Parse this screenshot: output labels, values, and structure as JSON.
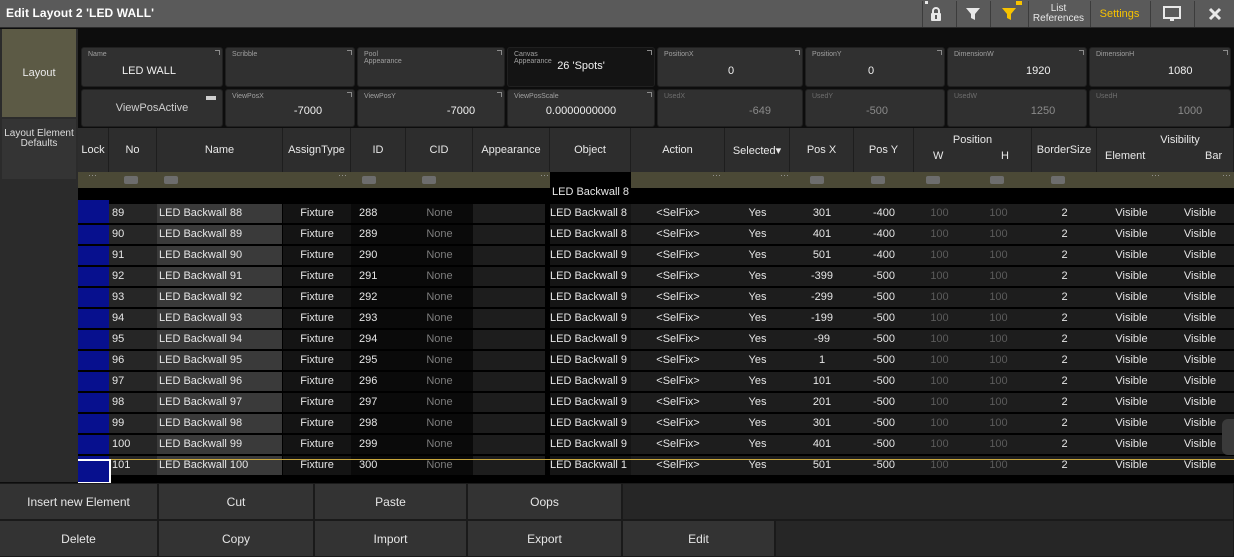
{
  "window": {
    "title": "Edit Layout 2 'LED WALL'"
  },
  "titlebar": {
    "list_references": "List References",
    "settings": "Settings"
  },
  "left_tabs": [
    {
      "label": "Layout"
    },
    {
      "label": "Layout Element Defaults"
    }
  ],
  "fields_row1": [
    {
      "label": "Name",
      "value": "LED WALL"
    },
    {
      "label": "Scribble",
      "value": ""
    },
    {
      "label": "Pool Appearance",
      "value": ""
    },
    {
      "label": "Canvas Appearance",
      "value": "26 'Spots'"
    },
    {
      "label": "PositionX",
      "value": "0"
    },
    {
      "label": "PositionY",
      "value": "0"
    },
    {
      "label": "DimensionW",
      "value": "1920"
    },
    {
      "label": "DimensionH",
      "value": "1080"
    }
  ],
  "fields_row2": [
    {
      "label": "",
      "value": "ViewPosActive"
    },
    {
      "label": "ViewPosX",
      "value": "-7000"
    },
    {
      "label": "ViewPosY",
      "value": "-7000"
    },
    {
      "label": "ViewPosScale",
      "value": "0.0000000000"
    },
    {
      "label": "UsedX",
      "value": "-649"
    },
    {
      "label": "UsedY",
      "value": "-500"
    },
    {
      "label": "UsedW",
      "value": "1250"
    },
    {
      "label": "UsedH",
      "value": "1000"
    }
  ],
  "table": {
    "headers": {
      "lock": "Lock",
      "no": "No",
      "name": "Name",
      "assign": "AssignType",
      "id": "ID",
      "cid": "CID",
      "appearance": "Appearance",
      "object": "Object",
      "action": "Action",
      "selected": "Selected▾",
      "posx": "Pos X",
      "posy": "Pos Y",
      "position": "Position",
      "w": "W",
      "h": "H",
      "bordersize": "BorderSize",
      "visibility": "Visibility",
      "element": "Element",
      "bar": "Bar"
    },
    "first_row_object": "LED Backwall 8",
    "rows": [
      {
        "no": "89",
        "name": "LED Backwall 88",
        "assign": "Fixture",
        "id": "288",
        "cid": "None",
        "object": "LED Backwall 8",
        "action": "<SelFix>",
        "selected": "Yes",
        "posx": "301",
        "posy": "-400",
        "w": "100",
        "h": "100",
        "bs": "2",
        "ve": "Visible",
        "vb": "Visible"
      },
      {
        "no": "90",
        "name": "LED Backwall 89",
        "assign": "Fixture",
        "id": "289",
        "cid": "None",
        "object": "LED Backwall 8",
        "action": "<SelFix>",
        "selected": "Yes",
        "posx": "401",
        "posy": "-400",
        "w": "100",
        "h": "100",
        "bs": "2",
        "ve": "Visible",
        "vb": "Visible"
      },
      {
        "no": "91",
        "name": "LED Backwall 90",
        "assign": "Fixture",
        "id": "290",
        "cid": "None",
        "object": "LED Backwall 9",
        "action": "<SelFix>",
        "selected": "Yes",
        "posx": "501",
        "posy": "-400",
        "w": "100",
        "h": "100",
        "bs": "2",
        "ve": "Visible",
        "vb": "Visible"
      },
      {
        "no": "92",
        "name": "LED Backwall 91",
        "assign": "Fixture",
        "id": "291",
        "cid": "None",
        "object": "LED Backwall 9",
        "action": "<SelFix>",
        "selected": "Yes",
        "posx": "-399",
        "posy": "-500",
        "w": "100",
        "h": "100",
        "bs": "2",
        "ve": "Visible",
        "vb": "Visible"
      },
      {
        "no": "93",
        "name": "LED Backwall 92",
        "assign": "Fixture",
        "id": "292",
        "cid": "None",
        "object": "LED Backwall 9",
        "action": "<SelFix>",
        "selected": "Yes",
        "posx": "-299",
        "posy": "-500",
        "w": "100",
        "h": "100",
        "bs": "2",
        "ve": "Visible",
        "vb": "Visible"
      },
      {
        "no": "94",
        "name": "LED Backwall 93",
        "assign": "Fixture",
        "id": "293",
        "cid": "None",
        "object": "LED Backwall 9",
        "action": "<SelFix>",
        "selected": "Yes",
        "posx": "-199",
        "posy": "-500",
        "w": "100",
        "h": "100",
        "bs": "2",
        "ve": "Visible",
        "vb": "Visible"
      },
      {
        "no": "95",
        "name": "LED Backwall 94",
        "assign": "Fixture",
        "id": "294",
        "cid": "None",
        "object": "LED Backwall 9",
        "action": "<SelFix>",
        "selected": "Yes",
        "posx": "-99",
        "posy": "-500",
        "w": "100",
        "h": "100",
        "bs": "2",
        "ve": "Visible",
        "vb": "Visible"
      },
      {
        "no": "96",
        "name": "LED Backwall 95",
        "assign": "Fixture",
        "id": "295",
        "cid": "None",
        "object": "LED Backwall 9",
        "action": "<SelFix>",
        "selected": "Yes",
        "posx": "1",
        "posy": "-500",
        "w": "100",
        "h": "100",
        "bs": "2",
        "ve": "Visible",
        "vb": "Visible"
      },
      {
        "no": "97",
        "name": "LED Backwall 96",
        "assign": "Fixture",
        "id": "296",
        "cid": "None",
        "object": "LED Backwall 9",
        "action": "<SelFix>",
        "selected": "Yes",
        "posx": "101",
        "posy": "-500",
        "w": "100",
        "h": "100",
        "bs": "2",
        "ve": "Visible",
        "vb": "Visible"
      },
      {
        "no": "98",
        "name": "LED Backwall 97",
        "assign": "Fixture",
        "id": "297",
        "cid": "None",
        "object": "LED Backwall 9",
        "action": "<SelFix>",
        "selected": "Yes",
        "posx": "201",
        "posy": "-500",
        "w": "100",
        "h": "100",
        "bs": "2",
        "ve": "Visible",
        "vb": "Visible"
      },
      {
        "no": "99",
        "name": "LED Backwall 98",
        "assign": "Fixture",
        "id": "298",
        "cid": "None",
        "object": "LED Backwall 9",
        "action": "<SelFix>",
        "selected": "Yes",
        "posx": "301",
        "posy": "-500",
        "w": "100",
        "h": "100",
        "bs": "2",
        "ve": "Visible",
        "vb": "Visible"
      },
      {
        "no": "100",
        "name": "LED Backwall 99",
        "assign": "Fixture",
        "id": "299",
        "cid": "None",
        "object": "LED Backwall 9",
        "action": "<SelFix>",
        "selected": "Yes",
        "posx": "401",
        "posy": "-500",
        "w": "100",
        "h": "100",
        "bs": "2",
        "ve": "Visible",
        "vb": "Visible"
      },
      {
        "no": "101",
        "name": "LED Backwall 100",
        "assign": "Fixture",
        "id": "300",
        "cid": "None",
        "object": "LED Backwall 1",
        "action": "<SelFix>",
        "selected": "Yes",
        "posx": "501",
        "posy": "-500",
        "w": "100",
        "h": "100",
        "bs": "2",
        "ve": "Visible",
        "vb": "Visible"
      }
    ]
  },
  "bottom_buttons": {
    "row1": [
      "Insert new Element",
      "Cut",
      "Paste",
      "Oops"
    ],
    "row2": [
      "Delete",
      "Copy",
      "Import",
      "Export",
      "Edit"
    ]
  },
  "colors": {
    "accent_yellow": "#f7c300",
    "lock_blue": "#07108e",
    "filter_olive": "#4b4936"
  }
}
